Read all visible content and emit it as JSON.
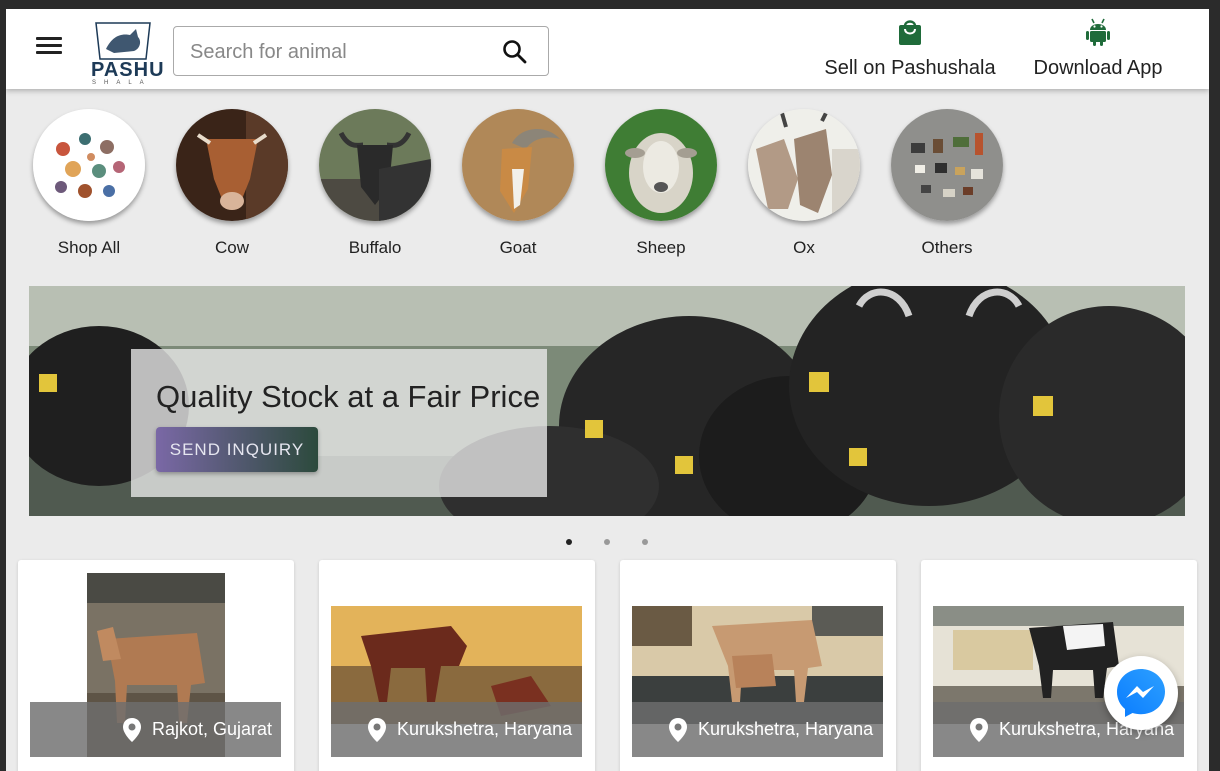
{
  "header": {
    "logo_text": "PASHU",
    "logo_subtext": "SHALA",
    "search_placeholder": "Search for animal",
    "sell_label": "Sell on Pashushala",
    "download_label": "Download App"
  },
  "categories": [
    {
      "label": "Shop All",
      "icon": "animals-collage"
    },
    {
      "label": "Cow",
      "icon": "cow-photo"
    },
    {
      "label": "Buffalo",
      "icon": "buffalo-photo"
    },
    {
      "label": "Goat",
      "icon": "goat-photo"
    },
    {
      "label": "Sheep",
      "icon": "sheep-photo"
    },
    {
      "label": "Ox",
      "icon": "ox-photo"
    },
    {
      "label": "Others",
      "icon": "others-photo"
    }
  ],
  "banner": {
    "title": "Quality Stock at a Fair Price",
    "button_label": "SEND INQUIRY",
    "slides_count": 3,
    "active_slide": 1
  },
  "listings": [
    {
      "location": "Rajkot, Gujarat"
    },
    {
      "location": "Kurukshetra, Haryana"
    },
    {
      "location": "Kurukshetra, Haryana"
    },
    {
      "location": "Kurukshetra, Haryana"
    }
  ],
  "colors": {
    "icon_green": "#1f6b3a",
    "logo_navy": "#1d3a57",
    "messenger_blue": "#0a7cff"
  }
}
